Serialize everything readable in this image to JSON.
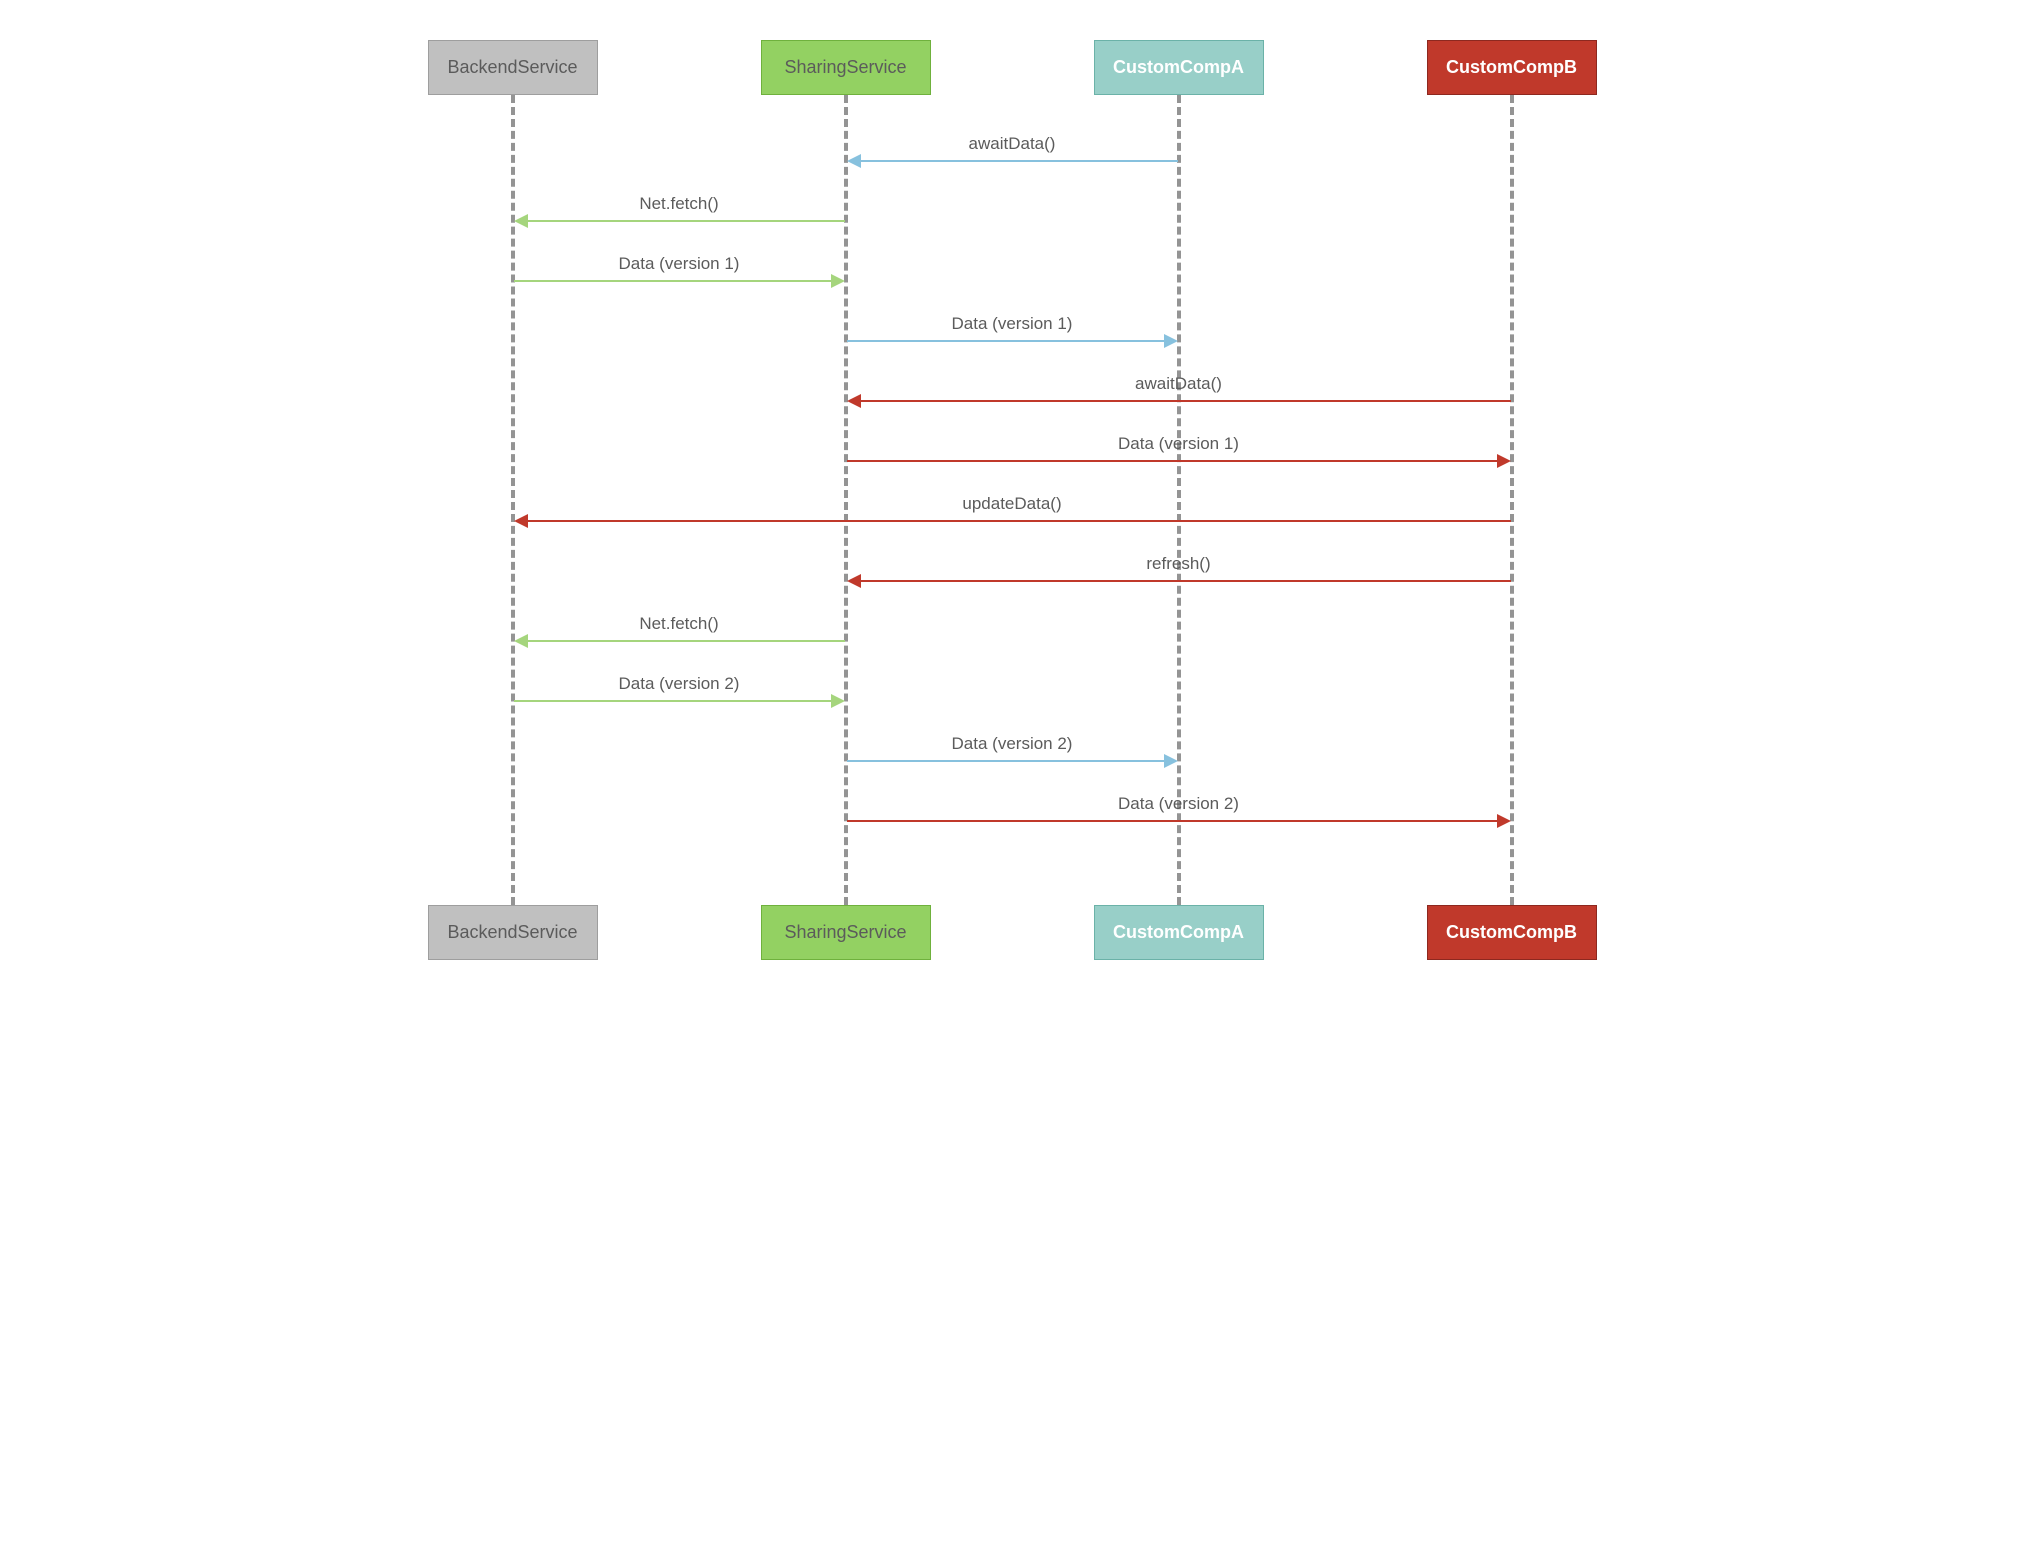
{
  "participants": {
    "backend": "BackendService",
    "sharing": "SharingService",
    "compA": "CustomCompA",
    "compB": "CustomCompB"
  },
  "messages": {
    "m1": "awaitData()",
    "m2": "Net.fetch()",
    "m3": "Data (version 1)",
    "m4": "Data (version 1)",
    "m5": "awaitData()",
    "m6": "Data (version 1)",
    "m7": "updateData()",
    "m8": "refresh()",
    "m9": "Net.fetch()",
    "m10": "Data (version 2)",
    "m11": "Data (version 2)",
    "m12": "Data (version 2)"
  },
  "chart_data": {
    "type": "sequence-diagram",
    "participants": [
      {
        "id": "backend",
        "label": "BackendService",
        "color": "gray"
      },
      {
        "id": "sharing",
        "label": "SharingService",
        "color": "green"
      },
      {
        "id": "compA",
        "label": "CustomCompA",
        "color": "teal"
      },
      {
        "id": "compB",
        "label": "CustomCompB",
        "color": "red"
      }
    ],
    "messages": [
      {
        "from": "compA",
        "to": "sharing",
        "label": "awaitData()",
        "color": "blue"
      },
      {
        "from": "sharing",
        "to": "backend",
        "label": "Net.fetch()",
        "color": "green"
      },
      {
        "from": "backend",
        "to": "sharing",
        "label": "Data (version 1)",
        "color": "green"
      },
      {
        "from": "sharing",
        "to": "compA",
        "label": "Data (version 1)",
        "color": "blue"
      },
      {
        "from": "compB",
        "to": "sharing",
        "label": "awaitData()",
        "color": "red"
      },
      {
        "from": "sharing",
        "to": "compB",
        "label": "Data (version 1)",
        "color": "red"
      },
      {
        "from": "compB",
        "to": "backend",
        "label": "updateData()",
        "color": "red"
      },
      {
        "from": "compB",
        "to": "sharing",
        "label": "refresh()",
        "color": "red"
      },
      {
        "from": "sharing",
        "to": "backend",
        "label": "Net.fetch()",
        "color": "green"
      },
      {
        "from": "backend",
        "to": "sharing",
        "label": "Data (version 2)",
        "color": "green"
      },
      {
        "from": "sharing",
        "to": "compA",
        "label": "Data (version 2)",
        "color": "blue"
      },
      {
        "from": "sharing",
        "to": "compB",
        "label": "Data (version 2)",
        "color": "red"
      }
    ]
  }
}
